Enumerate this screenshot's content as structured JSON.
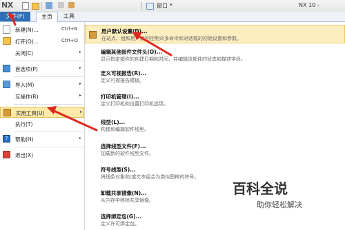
{
  "titlebar": {
    "logo": "NX",
    "window_label": "窗口",
    "window_caret": "▾",
    "app_title": "NX 10 -"
  },
  "tabs": [
    {
      "label": "文件(F)"
    },
    {
      "label": "主页"
    },
    {
      "label": "工具"
    }
  ],
  "left_menu": [
    {
      "label": "新建(N)...",
      "shortcut": "Ctrl+N",
      "icon": "new-file-icon",
      "color": "#ffffff"
    },
    {
      "label": "打开(O)...",
      "shortcut": "Ctrl+O",
      "icon": "open-folder-icon",
      "color": "#f2c44e"
    },
    {
      "label": "关闭(C)",
      "arrow": "▸",
      "icon": "close-icon",
      "color": "#ffffff"
    },
    {
      "label": "首选项(P)",
      "arrow": "▸",
      "icon": "preferences-icon",
      "color": "#4a8fd4"
    },
    {
      "label": "导入(M)",
      "arrow": "▸",
      "icon": "import-icon",
      "color": "#5b9bd5"
    },
    {
      "label": "互操作(R)",
      "arrow": "▸",
      "icon": "interop-icon",
      "color": "#ffffff"
    },
    {
      "label": "实用工具(U)",
      "arrow": "▸",
      "icon": "utilities-icon",
      "color": "#d79b3a"
    },
    {
      "label": "执行(T)",
      "arrow": "▸",
      "icon": "execute-icon",
      "color": "#ffffff"
    },
    {
      "label": "帮助(H)",
      "arrow": "▸",
      "icon": "help-icon",
      "color": "#2b6cc4"
    },
    {
      "label": "退出(X)",
      "icon": "exit-icon",
      "color": "#d9443a"
    }
  ],
  "submenu": [
    {
      "title": "用户默认设置(D)...",
      "desc": "在站点、组和用户级别控制众多命令和对话框的初始设置和参数。"
    },
    {
      "title": "编辑其他部件文件头(O)...",
      "desc": "显示指定部件的创建日期和时间，并编辑该部件的状态和描述字段。"
    },
    {
      "title": "定义可视报告(R)...",
      "desc": "定义可视报告模板。"
    },
    {
      "title": "打印机管理(I)...",
      "desc": "定义打印机和设置打印机选项。"
    },
    {
      "title": "线型(L)...",
      "desc": "构建和编辑软件线型。"
    },
    {
      "title": "选择线型文件(F)...",
      "desc": "加载新的软件线型文件。"
    },
    {
      "title": "符号线型(S)...",
      "desc": "将线条对象和/或文本组合为类似图样的符号。"
    },
    {
      "title": "卸载共享镜像(N)...",
      "desc": "从内存中移除共享镜像。"
    },
    {
      "title": "选择绑定包(G)...",
      "desc": "定义许可绑定包。"
    }
  ],
  "watermark": {
    "logo": "百科全说",
    "sub": "助你轻松解决"
  },
  "colors": {
    "accent": "#2f6fb5",
    "highlight": "#fde9a8",
    "arrow": "#e0281e"
  }
}
